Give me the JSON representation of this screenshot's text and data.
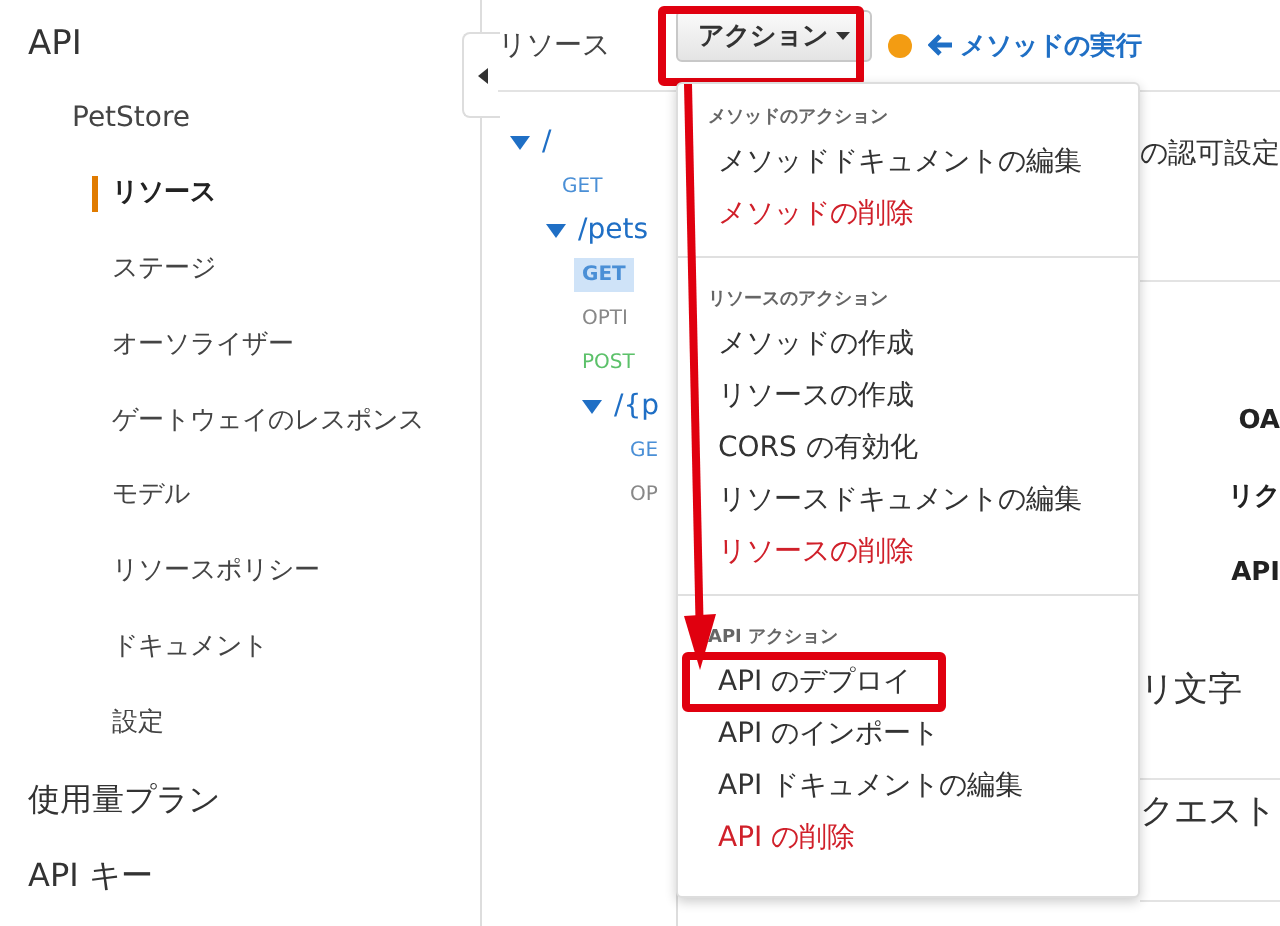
{
  "sidebar": {
    "title": "API",
    "api_name": "PetStore",
    "items": [
      {
        "label": "リソース",
        "selected": true
      },
      {
        "label": "ステージ",
        "selected": false
      },
      {
        "label": "オーソライザー",
        "selected": false
      },
      {
        "label": "ゲートウェイのレスポンス",
        "selected": false
      },
      {
        "label": "モデル",
        "selected": false
      },
      {
        "label": "リソースポリシー",
        "selected": false
      },
      {
        "label": "ドキュメント",
        "selected": false
      },
      {
        "label": "設定",
        "selected": false
      }
    ],
    "sections": [
      "使用量プラン",
      "API キー"
    ]
  },
  "toolbar": {
    "title": "リソース",
    "action_button": {
      "label": "アクション",
      "annotated": true
    },
    "back_link": "メソッドの実行"
  },
  "tree": [
    {
      "kind": "resource",
      "label": "/",
      "children": [
        {
          "kind": "method",
          "label": "GET",
          "color": "#4a8fd6",
          "selected": false
        },
        {
          "kind": "resource",
          "label": "/pets",
          "children": [
            {
              "kind": "method",
              "label": "GET",
              "color": "#4a8fd6",
              "selected": true
            },
            {
              "kind": "method",
              "label": "OPTI",
              "color": "#888888",
              "selected": false
            },
            {
              "kind": "method",
              "label": "POST",
              "color": "#5cc16a",
              "selected": false
            },
            {
              "kind": "resource",
              "label": "/{p",
              "children": [
                {
                  "kind": "method",
                  "label": "GE",
                  "color": "#4a8fd6",
                  "selected": false
                },
                {
                  "kind": "method",
                  "label": "OP",
                  "color": "#888888",
                  "selected": false
                }
              ]
            }
          ]
        }
      ]
    }
  ],
  "menu": {
    "groups": [
      {
        "header": "メソッドのアクション",
        "items": [
          {
            "label": "メソッドドキュメントの編集",
            "danger": false,
            "annotated": false
          },
          {
            "label": "メソッドの削除",
            "danger": true,
            "annotated": false
          }
        ]
      },
      {
        "header": "リソースのアクション",
        "items": [
          {
            "label": "メソッドの作成",
            "danger": false,
            "annotated": false
          },
          {
            "label": "リソースの作成",
            "danger": false,
            "annotated": false
          },
          {
            "label": "CORS の有効化",
            "danger": false,
            "annotated": false
          },
          {
            "label": "リソースドキュメントの編集",
            "danger": false,
            "annotated": false
          },
          {
            "label": "リソースの削除",
            "danger": true,
            "annotated": false
          }
        ]
      },
      {
        "header": "API アクション",
        "items": [
          {
            "label": "API のデプロイ",
            "danger": false,
            "annotated": true
          },
          {
            "label": "API のインポート",
            "danger": false,
            "annotated": false
          },
          {
            "label": "API ドキュメントの編集",
            "danger": false,
            "annotated": false
          },
          {
            "label": "API の削除",
            "danger": true,
            "annotated": false
          }
        ]
      }
    ]
  },
  "content": {
    "auth_heading": "の認可設定",
    "labels": [
      "OA",
      "リク",
      "API"
    ],
    "sections": [
      "リ文字",
      "クエスト"
    ]
  }
}
